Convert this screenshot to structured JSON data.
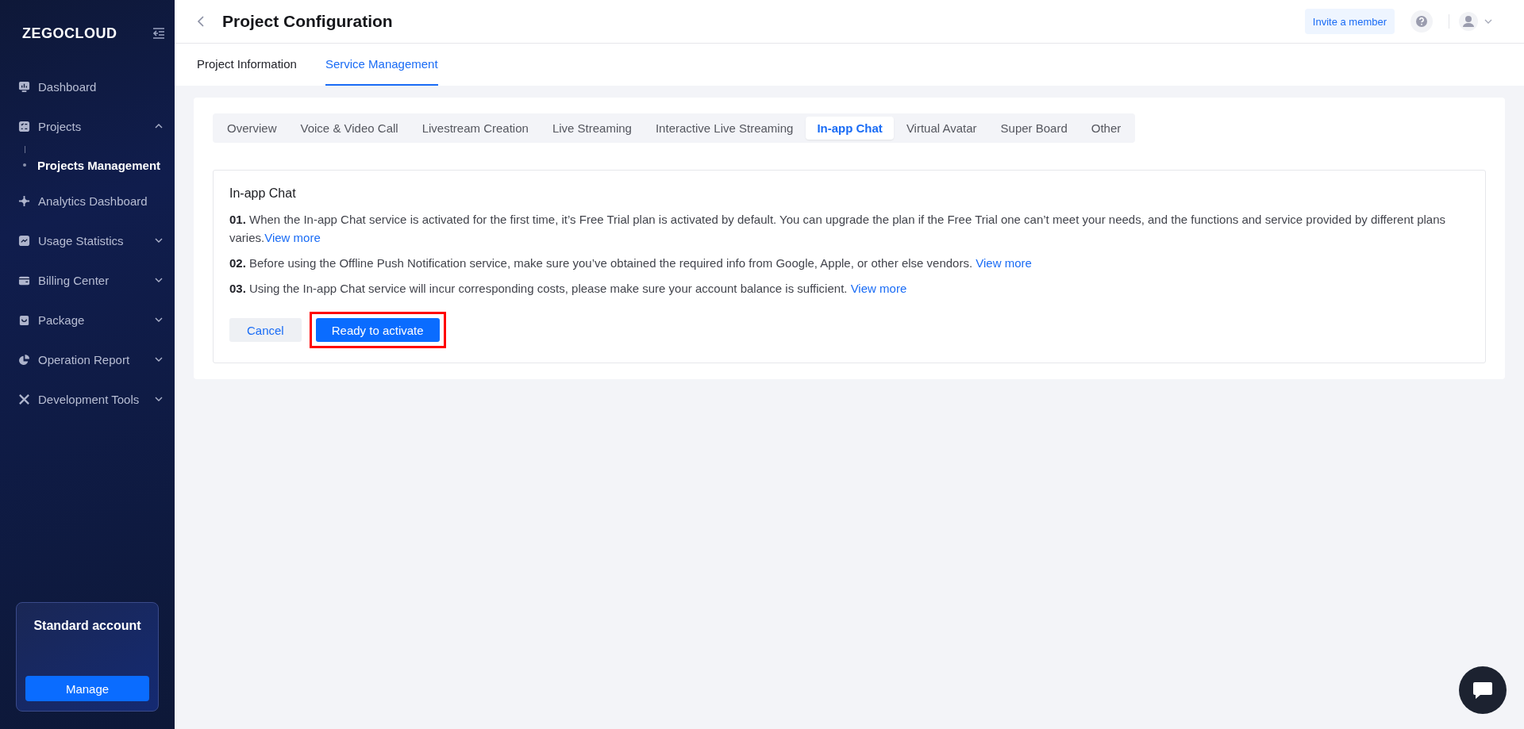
{
  "sidebar": {
    "logo": "ZEGOCLOUD",
    "items": [
      {
        "label": "Dashboard",
        "selected": false
      },
      {
        "label": "Projects",
        "selected": false,
        "expanded": true,
        "children": [
          {
            "label": "Projects Management",
            "selected": true
          }
        ]
      },
      {
        "label": "Analytics Dashboard",
        "selected": false
      },
      {
        "label": "Usage Statistics",
        "selected": false,
        "expanded": false
      },
      {
        "label": "Billing Center",
        "selected": false,
        "expanded": false
      },
      {
        "label": "Package",
        "selected": false,
        "expanded": false
      },
      {
        "label": "Operation Report",
        "selected": false,
        "expanded": false
      },
      {
        "label": "Development Tools",
        "selected": false,
        "expanded": false
      }
    ],
    "account": {
      "title": "Standard account",
      "button": "Manage"
    }
  },
  "header": {
    "title": "Project Configuration",
    "invite_button": "Invite a member"
  },
  "tabs": [
    {
      "label": "Project Information",
      "selected": false
    },
    {
      "label": "Service Management",
      "selected": true
    }
  ],
  "service_tabs": [
    {
      "label": "Overview",
      "selected": false
    },
    {
      "label": "Voice & Video Call",
      "selected": false
    },
    {
      "label": "Livestream Creation",
      "selected": false
    },
    {
      "label": "Live Streaming",
      "selected": false
    },
    {
      "label": "Interactive Live Streaming",
      "selected": false
    },
    {
      "label": "In-app Chat",
      "selected": true
    },
    {
      "label": "Virtual Avatar",
      "selected": false
    },
    {
      "label": "Super Board",
      "selected": false
    },
    {
      "label": "Other",
      "selected": false
    }
  ],
  "panel": {
    "title": "In-app Chat",
    "notes": [
      {
        "number": "01.",
        "text": "When the In-app Chat service is activated for the first time, it’s Free Trial plan is activated by default. You can upgrade the plan if the Free Trial one can’t meet your needs, and the functions and service provided by different plans varies.",
        "link": "View more"
      },
      {
        "number": "02.",
        "text": "Before using the Offline Push Notification service, make sure you’ve obtained the required info from Google, Apple, or other else vendors. ",
        "link": "View more"
      },
      {
        "number": "03.",
        "text": "Using the In-app Chat service will incur corresponding costs, please make sure your account balance is sufficient. ",
        "link": "View more"
      }
    ],
    "cancel_button": "Cancel",
    "activate_button": {
      "label": "Ready to activate",
      "highlighted": true
    }
  }
}
